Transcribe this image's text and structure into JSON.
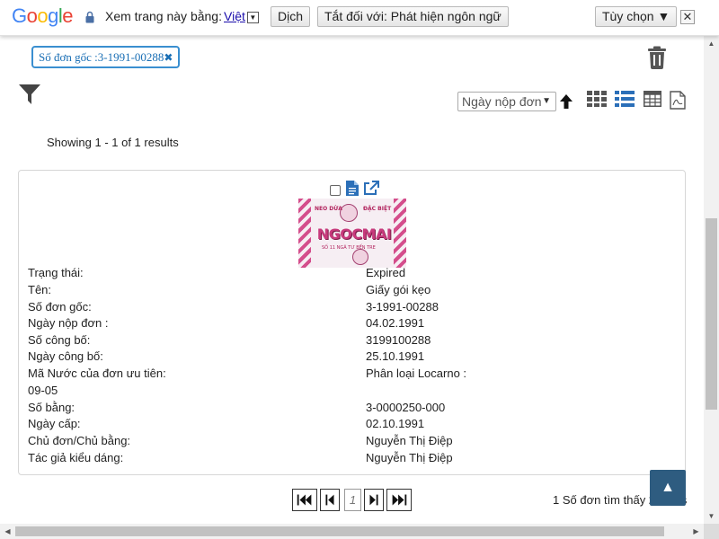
{
  "translate_bar": {
    "logo_letters": [
      "G",
      "o",
      "o",
      "g",
      "l",
      "e"
    ],
    "logo_colors": [
      "#4285F4",
      "#EA4335",
      "#FBBC05",
      "#4285F4",
      "#34A853",
      "#EA4335"
    ],
    "view_in_label": "Xem trang này bằng:",
    "language": "Việt",
    "translate_button": "Dịch",
    "always_off_button": "Tắt đối với: Phát hiện ngôn ngữ",
    "options_button": "Tùy chọn ▼",
    "close_label": "✕"
  },
  "filter_chip": {
    "label": "Số đơn gốc :3-1991-00288",
    "remove": "✖"
  },
  "sort": {
    "selected": "Ngày nộp đơn",
    "direction": "ascending"
  },
  "results_summary": "Showing 1 - 1 of 1 results",
  "record": {
    "fields": [
      {
        "label": "Trạng thái:",
        "value": "Expired"
      },
      {
        "label": "Tên:",
        "value": "Giấy gói kẹo"
      },
      {
        "label": "Số đơn gốc:",
        "value": "3-1991-00288"
      },
      {
        "label": "Ngày nộp đơn :",
        "value": "04.02.1991"
      },
      {
        "label": "Số công bố:",
        "value": "3199100288"
      },
      {
        "label": "Ngày công bố:",
        "value": "25.10.1991"
      },
      {
        "label": "Mã Nước của đơn ưu tiên:",
        "value": "Phân loại Locarno :"
      },
      {
        "label": "09-05",
        "value": ""
      },
      {
        "label": "Số bằng:",
        "value": "3-0000250-000"
      },
      {
        "label": "Ngày cấp:",
        "value": "02.10.1991"
      },
      {
        "label": "Chủ đơn/Chủ bằng:",
        "value": "Nguyễn Thị Điệp"
      },
      {
        "label": "Tác giả kiểu dáng:",
        "value": "Nguyễn Thị Điệp"
      }
    ],
    "thumbnail": {
      "top_left": "NEO DỪA",
      "top_right": "ĐẶC BIỆT",
      "brand": "NGOCMAI",
      "tagline": "SỐ 11 NGÃ TƯ BẾN TRE"
    }
  },
  "pagination": {
    "current_page": "1",
    "found_text": "1 Số đơn tìm thấy 259 ms"
  },
  "back_to_top": "▲",
  "colors": {
    "chip_border": "#3a8fd0",
    "icon_blue": "#2b6fb8",
    "back_to_top_bg": "#2e5c80"
  }
}
